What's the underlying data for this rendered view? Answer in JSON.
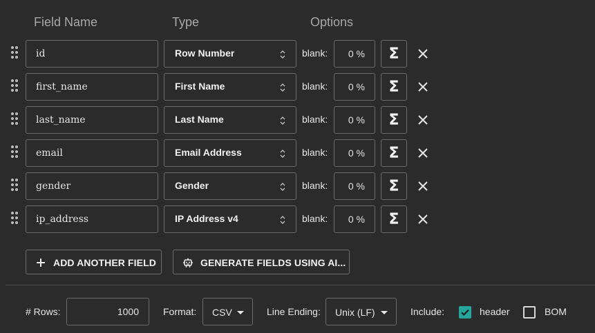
{
  "columns": {
    "field_name": "Field Name",
    "type": "Type",
    "options": "Options"
  },
  "fields": [
    {
      "name": "id",
      "type": "Row Number",
      "blank_label": "blank:",
      "blank": "0 %"
    },
    {
      "name": "first_name",
      "type": "First Name",
      "blank_label": "blank:",
      "blank": "0 %"
    },
    {
      "name": "last_name",
      "type": "Last Name",
      "blank_label": "blank:",
      "blank": "0 %"
    },
    {
      "name": "email",
      "type": "Email Address",
      "blank_label": "blank:",
      "blank": "0 %"
    },
    {
      "name": "gender",
      "type": "Gender",
      "blank_label": "blank:",
      "blank": "0 %"
    },
    {
      "name": "ip_address",
      "type": "IP Address v4",
      "blank_label": "blank:",
      "blank": "0 %"
    }
  ],
  "formula_symbol": "Σ",
  "actions": {
    "add_field": "ADD ANOTHER FIELD",
    "generate_ai": "GENERATE FIELDS USING AI..."
  },
  "footer": {
    "rows_label": "# Rows:",
    "rows_value": "1000",
    "format_label": "Format:",
    "format_value": "CSV",
    "line_ending_label": "Line Ending:",
    "line_ending_value": "Unix (LF)",
    "include_label": "Include:",
    "header_label": "header",
    "header_checked": true,
    "bom_label": "BOM",
    "bom_checked": false
  },
  "colors": {
    "background": "#2b2b2b",
    "border": "#6b6b6b",
    "accent": "#26a69a",
    "header_text": "#a8a8a8"
  },
  "icons": {
    "drag": "drag-handle-icon",
    "chevron": "up-down-chevron-icon",
    "sigma": "sigma-icon",
    "delete": "close-icon",
    "add": "plus-icon",
    "ai": "robot-icon",
    "caret": "caret-down-icon",
    "check": "check-icon"
  }
}
